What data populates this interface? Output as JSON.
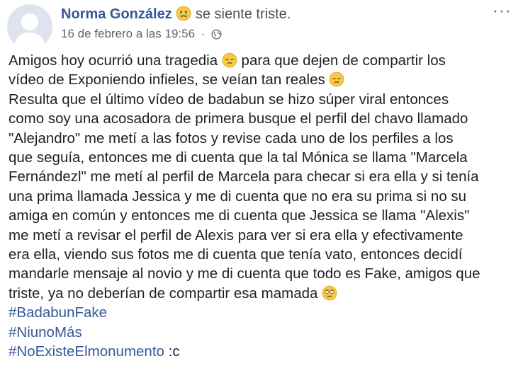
{
  "post": {
    "author": "Norma González",
    "feeling": "se siente triste.",
    "timestamp": "16 de febrero a las 19:56",
    "separator": "·",
    "more_menu": "···",
    "icons": {
      "feeling": "crying-face-emoji",
      "audience": "globe-icon",
      "emoji_1": "pensive-face-emoji",
      "emoji_2": "pensive-face-emoji",
      "emoji_3": "rolling-eyes-emoji"
    },
    "text": {
      "l1": "Amigos hoy ocurrió una tragedia",
      "l1b": "para que dejen de compartir los",
      "l2": "vídeo de Exponiendo infieles, se veían tan reales",
      "l3": "Resulta que el último vídeo de badabun se hizo súper viral entonces",
      "l4": "como soy una acosadora de primera busque el perfil del chavo llamado",
      "l5": "\"Alejandro\" me metí a las fotos y revise cada uno de los perfiles a los",
      "l6": "que seguía, entonces me di cuenta que la tal Mónica se llama \"Marcela",
      "l7": "Fernándezl\" me metí al perfil de Marcela para checar si era ella y si tenía",
      "l8": "una prima llamada Jessica y me di cuenta que no era su prima si no su",
      "l9": "amiga en común y entonces me di cuenta que Jessica se llama \"Alexis\"",
      "l10": "me metí a revisar el perfil de Alexis para ver si era ella y efectivamente",
      "l11": "era ella, viendo sus fotos me di cuenta que tenía vato, entonces decidí",
      "l12": "mandarle mensaje al novio y me di cuenta que todo es Fake, amigos que",
      "l13": "triste, ya no deberían de compartir esa mamada"
    },
    "hashtags": [
      "#BadabunFake",
      "#NiunoMás",
      "#NoExisteElmonumento"
    ],
    "trailing": ":c",
    "colors": {
      "link": "#365899",
      "text": "#1d2129",
      "meta": "#616770",
      "emoji": "#f7c843"
    }
  }
}
